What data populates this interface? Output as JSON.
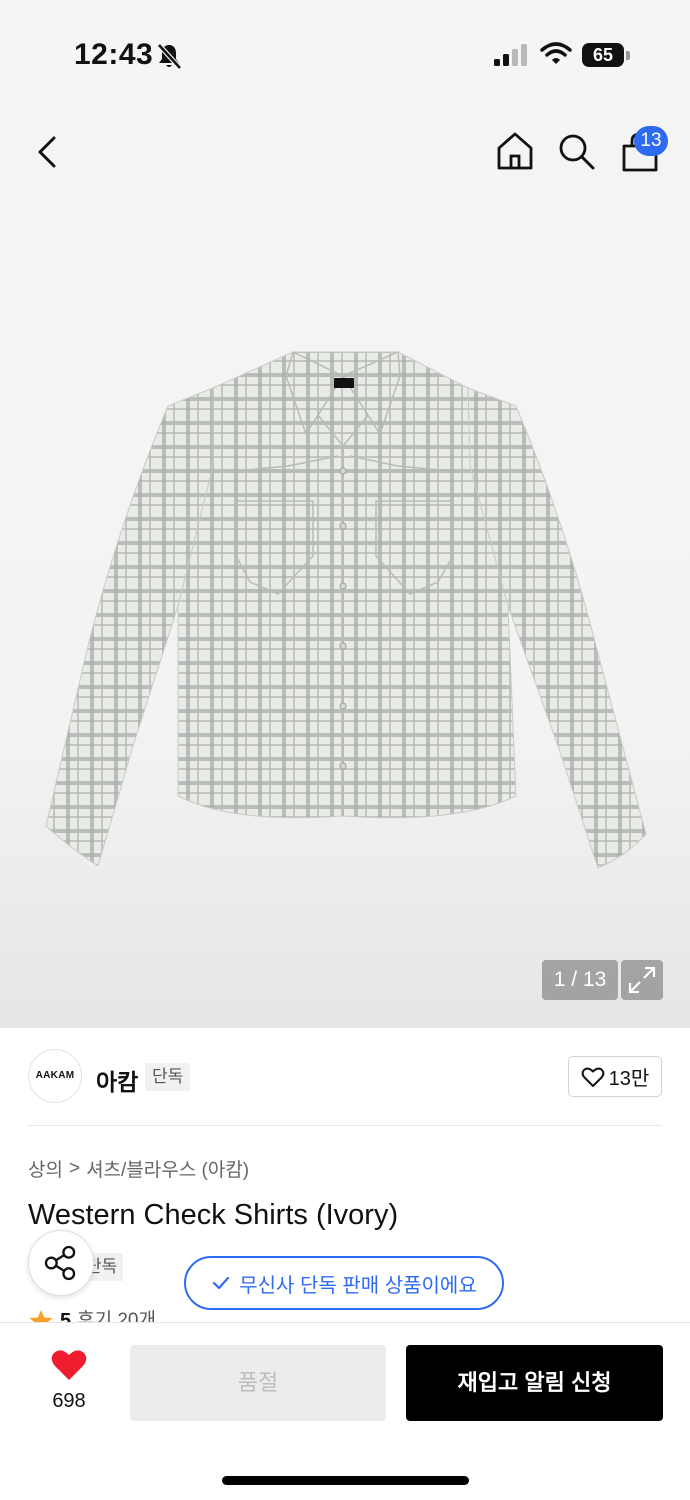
{
  "status_bar": {
    "time": "12:43",
    "battery": "65"
  },
  "header": {
    "cart_count": "13"
  },
  "gallery": {
    "page_indicator": "1 / 13",
    "shirt_label": "AAKAM"
  },
  "brand": {
    "logo_text": "AAKAM",
    "name": "아캄",
    "exclusive_tag": "단독",
    "like_count": "13만"
  },
  "breadcrumb": {
    "category": "상의",
    "separator": ">",
    "subcategory": "셔츠/블라우스 (아캄)"
  },
  "product": {
    "title": "Western Check Shirts (Ivory)",
    "tag": "단독",
    "exclusive_banner": "무신사 단독 판매 상품이에요",
    "rating_score": "5",
    "review_text": "후기 20개"
  },
  "bottom_bar": {
    "wish_count": "698",
    "soldout_label": "품절",
    "restock_label": "재입고 알림 신청"
  },
  "colors": {
    "accent_blue": "#2f6bf2",
    "heart_red": "#ee1c2e",
    "star_orange": "#f7a226"
  },
  "icons": [
    "bell-slash-icon",
    "signal-icon",
    "wifi-icon",
    "back-icon",
    "home-icon",
    "search-icon",
    "shopping-bag-icon",
    "expand-icon",
    "heart-outline-icon",
    "share-icon",
    "check-icon",
    "star-icon",
    "heart-filled-icon"
  ]
}
